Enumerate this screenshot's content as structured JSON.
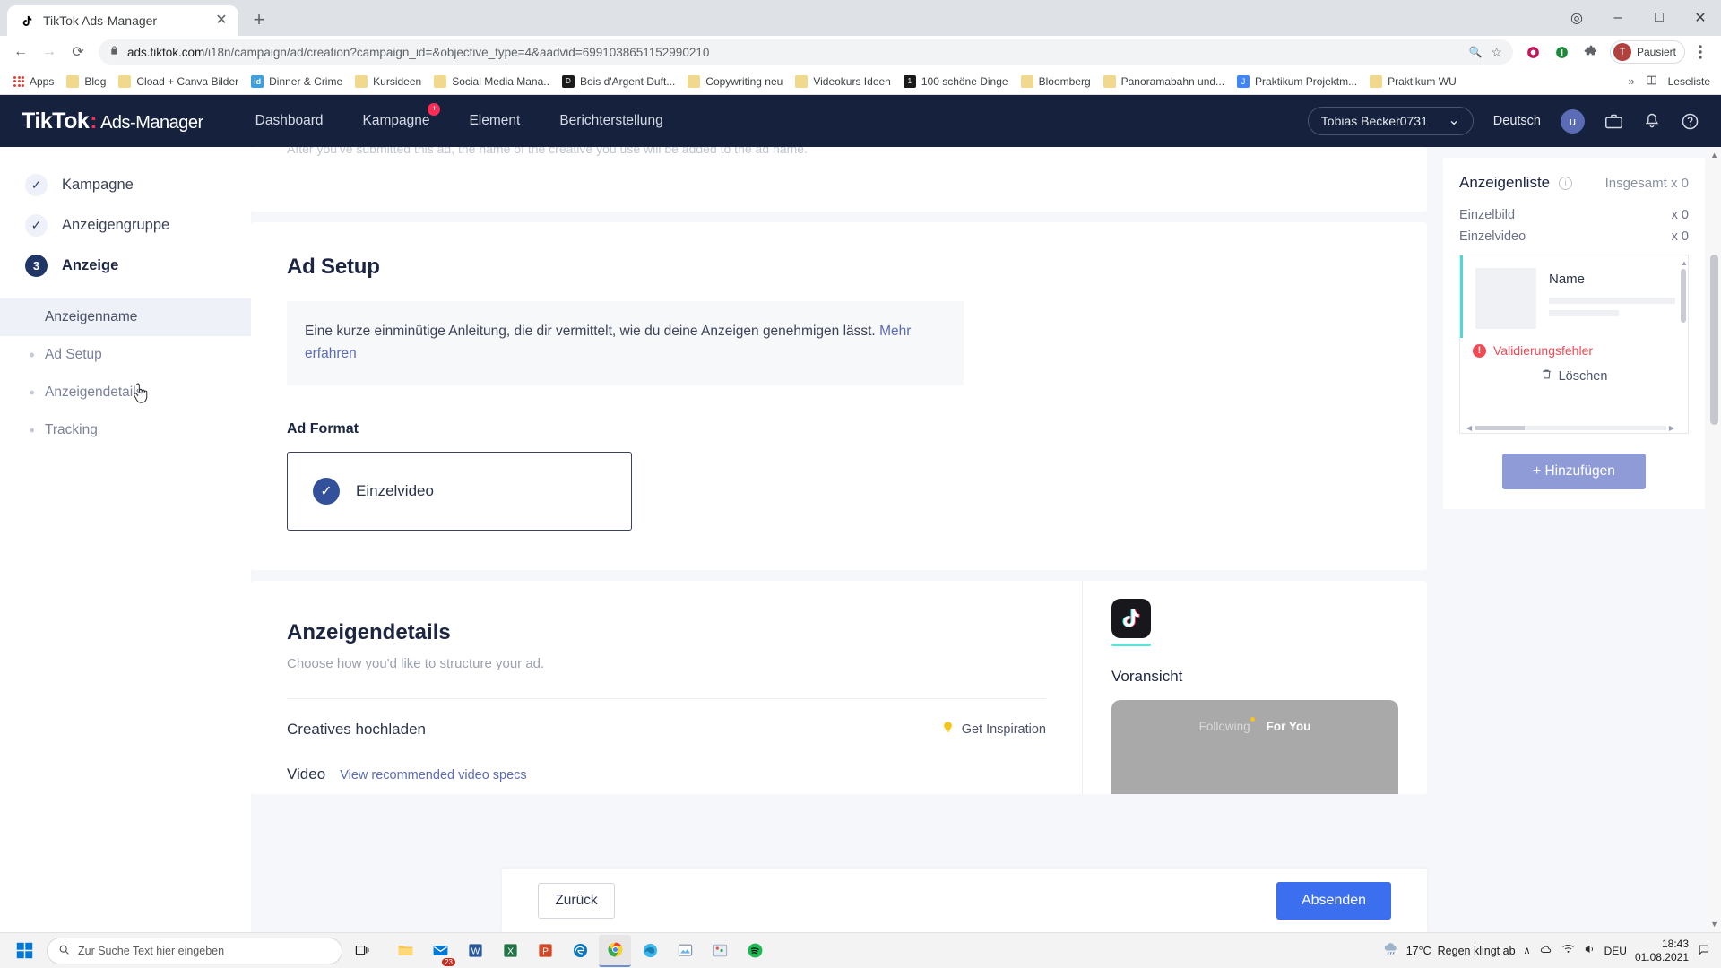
{
  "browser": {
    "tab": {
      "title": "TikTok Ads-Manager",
      "favicon": "tiktok-note-icon",
      "close": "✕"
    },
    "newtab_label": "+",
    "window_controls": {
      "minimize": "–",
      "maximize": "□",
      "close": "✕",
      "extra": "◎"
    },
    "nav": {
      "back": "←",
      "forward": "→",
      "reload": "⟳"
    },
    "omnibox": {
      "lock": "lock-icon",
      "url_host": "ads.tiktok.com",
      "url_path": "/i18n/campaign/ad/creation?campaign_id=&objective_type=4&aadvid=6991038651152990210",
      "zoom_icon": "🔍",
      "star_icon": "☆"
    },
    "profile": {
      "initial": "T",
      "label": "Pausiert"
    },
    "bookmarks": [
      {
        "label": "Apps",
        "icon": "apps-grid-icon"
      },
      {
        "label": "Blog",
        "icon": "folder-icon"
      },
      {
        "label": "Cload + Canva Bilder",
        "icon": "folder-icon"
      },
      {
        "label": "Dinner & Crime",
        "icon": "id-icon"
      },
      {
        "label": "Kursideen",
        "icon": "folder-icon"
      },
      {
        "label": "Social Media Mana..",
        "icon": "folder-icon"
      },
      {
        "label": "Bois d'Argent Duft...",
        "icon": "dark-site-icon"
      },
      {
        "label": "Copywriting neu",
        "icon": "folder-icon"
      },
      {
        "label": "Videokurs Ideen",
        "icon": "folder-icon"
      },
      {
        "label": "100 schöne Dinge",
        "icon": "dark-site-icon"
      },
      {
        "label": "Bloomberg",
        "icon": "folder-icon"
      },
      {
        "label": "Panoramabahn und...",
        "icon": "folder-icon"
      },
      {
        "label": "Praktikum Projektm...",
        "icon": "docs-icon"
      },
      {
        "label": "Praktikum WU",
        "icon": "folder-icon"
      }
    ],
    "bookmarks_overflow": "»",
    "reading_list": "Leseliste"
  },
  "tiktok": {
    "logo": {
      "brand": "TikTok",
      "sub": "Ads-Manager"
    },
    "nav": [
      {
        "label": "Dashboard",
        "badge": null
      },
      {
        "label": "Kampagne",
        "badge": "+"
      },
      {
        "label": "Element",
        "badge": null
      },
      {
        "label": "Berichterstellung",
        "badge": null
      }
    ],
    "account": {
      "name": "Tobias Becker0731",
      "caret": "⌄"
    },
    "language": "Deutsch",
    "avatar_initial": "u",
    "header_icons": [
      "briefcase-icon",
      "bell-icon",
      "help-icon"
    ]
  },
  "sidebar": {
    "steps": [
      {
        "label": "Kampagne",
        "state": "done",
        "marker": "✓"
      },
      {
        "label": "Anzeigengruppe",
        "state": "done",
        "marker": "✓"
      },
      {
        "label": "Anzeige",
        "state": "current",
        "marker": "3"
      }
    ],
    "sub_items": [
      {
        "label": "Anzeigenname",
        "selected": true
      },
      {
        "label": "Ad Setup",
        "selected": false
      },
      {
        "label": "Anzeigendetails",
        "selected": false
      },
      {
        "label": "Tracking",
        "selected": false
      }
    ]
  },
  "main": {
    "cut_off_text": "After you've submitted this ad, the name of the creative you use will be added to the ad name.",
    "ad_setup": {
      "title": "Ad Setup",
      "notice_text": "Eine kurze einminütige Anleitung, die dir vermittelt, wie du deine Anzeigen genehmigen lässt. ",
      "notice_link": "Mehr erfahren",
      "format_label": "Ad Format",
      "format_option": "Einzelvideo",
      "format_check": "✓"
    },
    "ad_details": {
      "title": "Anzeigendetails",
      "subtitle": "Choose how you'd like to structure your ad.",
      "upload_row_label": "Creatives hochladen",
      "inspiration_label": "Get Inspiration",
      "inspiration_icon": "lightbulb-icon",
      "video_label": "Video",
      "video_specs_link": "View recommended video specs"
    },
    "preview": {
      "title": "Voransicht",
      "app_icon": "tiktok-app-icon",
      "tab_following": "Following",
      "tab_foryou": "For You"
    },
    "footer": {
      "back_label": "Zurück",
      "submit_label": "Absenden"
    }
  },
  "right_panel": {
    "title": "Anzeigenliste",
    "info_icon": "info-icon",
    "total_label": "Insgesamt x 0",
    "counts": [
      {
        "label": "Einzelbild",
        "value": "x 0"
      },
      {
        "label": "Einzelvideo",
        "value": "x 0"
      }
    ],
    "ad_item": {
      "name": "Name",
      "error_label": "Validierungsfehler",
      "error_icon": "error-icon",
      "delete_label": "Löschen",
      "delete_icon": "trash-icon"
    },
    "add_button": "+ Hinzufügen"
  },
  "taskbar": {
    "start_icon": "windows-icon",
    "search_placeholder": "Zur Suche Text hier eingeben",
    "search_icon": "search-icon",
    "task_view_icon": "task-view-icon",
    "apps": [
      {
        "name": "file-explorer-icon",
        "badge": null
      },
      {
        "name": "mail-icon",
        "badge": "23"
      },
      {
        "name": "word-icon",
        "badge": null
      },
      {
        "name": "excel-icon",
        "badge": null
      },
      {
        "name": "powerpoint-icon",
        "badge": null
      },
      {
        "name": "edge-legacy-icon",
        "badge": null
      },
      {
        "name": "chrome-icon",
        "badge": null,
        "active": true
      },
      {
        "name": "edge-icon",
        "badge": null
      },
      {
        "name": "photos-icon",
        "badge": null
      },
      {
        "name": "paint-icon",
        "badge": null
      },
      {
        "name": "spotify-icon",
        "badge": null
      }
    ],
    "weather": {
      "icon": "rain-icon",
      "temp": "17°C",
      "text": "Regen klingt ab"
    },
    "tray": {
      "chevron": "∧",
      "onedrive": "cloud-icon",
      "network": "network-icon",
      "volume": "volume-icon",
      "lang": "DEU"
    },
    "clock": {
      "time": "18:43",
      "date": "01.08.2021"
    },
    "notif_icon": "notification-icon"
  }
}
